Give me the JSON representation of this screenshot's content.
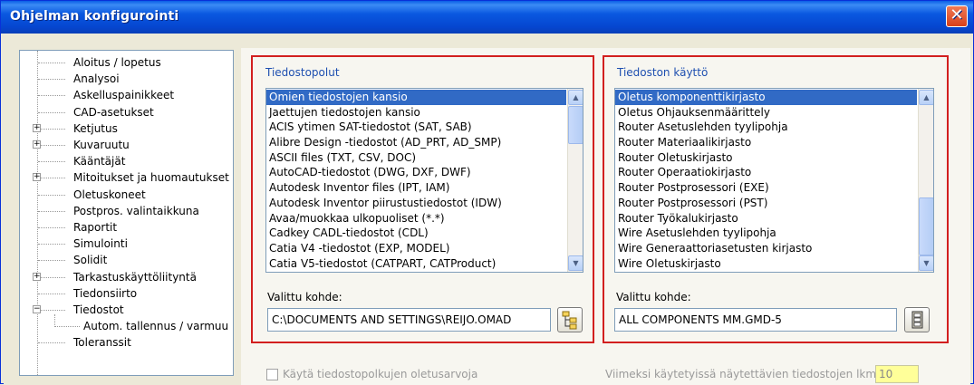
{
  "window": {
    "title": "Ohjelman konfigurointi",
    "close_icon": "close-icon"
  },
  "tree": {
    "items": [
      {
        "label": "Aloitus / lopetus",
        "expander": ""
      },
      {
        "label": "Analysoi",
        "expander": ""
      },
      {
        "label": "Askelluspainikkeet",
        "expander": ""
      },
      {
        "label": "CAD-asetukset",
        "expander": ""
      },
      {
        "label": "Ketjutus",
        "expander": "+"
      },
      {
        "label": "Kuvaruutu",
        "expander": "+"
      },
      {
        "label": "Kääntäjät",
        "expander": ""
      },
      {
        "label": "Mitoitukset ja huomautukset",
        "expander": "+"
      },
      {
        "label": "Oletuskoneet",
        "expander": ""
      },
      {
        "label": "Postpros. valintaikkuna",
        "expander": ""
      },
      {
        "label": "Raportit",
        "expander": ""
      },
      {
        "label": "Simulointi",
        "expander": ""
      },
      {
        "label": "Solidit",
        "expander": ""
      },
      {
        "label": "Tarkastuskäyttöliityntä",
        "expander": "+"
      },
      {
        "label": "Tiedonsiirto",
        "expander": ""
      },
      {
        "label": "Tiedostot",
        "expander": "−"
      },
      {
        "label": "Autom. tallennus / varmuu",
        "expander": ""
      },
      {
        "label": "Toleranssit",
        "expander": ""
      }
    ]
  },
  "file_paths": {
    "title": "Tiedostopolut",
    "items": [
      "Omien tiedostojen kansio",
      "Jaettujen tiedostojen kansio",
      "ACIS ytimen SAT-tiedostot (SAT, SAB)",
      "Alibre Design -tiedostot (AD_PRT, AD_SMP)",
      "ASCII files (TXT, CSV, DOC)",
      "AutoCAD-tiedostot (DWG, DXF, DWF)",
      "Autodesk Inventor files (IPT, IAM)",
      "Autodesk Inventor piirustustiedostot (IDW)",
      "Avaa/muokkaa ulkopuoliset (*.*)",
      "Cadkey CADL-tiedostot (CDL)",
      "Catia V4 -tiedostot (EXP, MODEL)",
      "Catia V5-tiedostot (CATPART, CATProduct)"
    ],
    "selected_index": 0,
    "selected_label": "Valittu kohde:",
    "selected_value": "C:\\DOCUMENTS AND SETTINGS\\REIJO.OMAD",
    "browse_icon": "folder-tree-icon"
  },
  "file_usage": {
    "title": "Tiedoston käyttö",
    "items": [
      "Oletus komponenttikirjasto",
      "Oletus Ohjauksenmäärittely",
      "Router Asetuslehden tyylipohja",
      "Router Materiaalikirjasto",
      "Router Oletuskirjasto",
      "Router Operaatiokirjasto",
      "Router Postprosessori (EXE)",
      "Router Postprosessori (PST)",
      "Router Työkalukirjasto",
      "Wire Asetuslehden tyylipohja",
      "Wire Generaattoriasetusten kirjasto",
      "Wire Oletuskirjasto"
    ],
    "selected_index": 0,
    "selected_label": "Valittu kohde:",
    "selected_value": "ALL COMPONENTS MM.GMD-5",
    "browse_icon": "file-cabinet-icon"
  },
  "bottom": {
    "checkbox_label": "Käytä tiedostopolkujen oletusarvoja",
    "recent_label": "Viimeksi käytetyissä näytettävien tiedostojen lkm",
    "recent_value": "10"
  }
}
